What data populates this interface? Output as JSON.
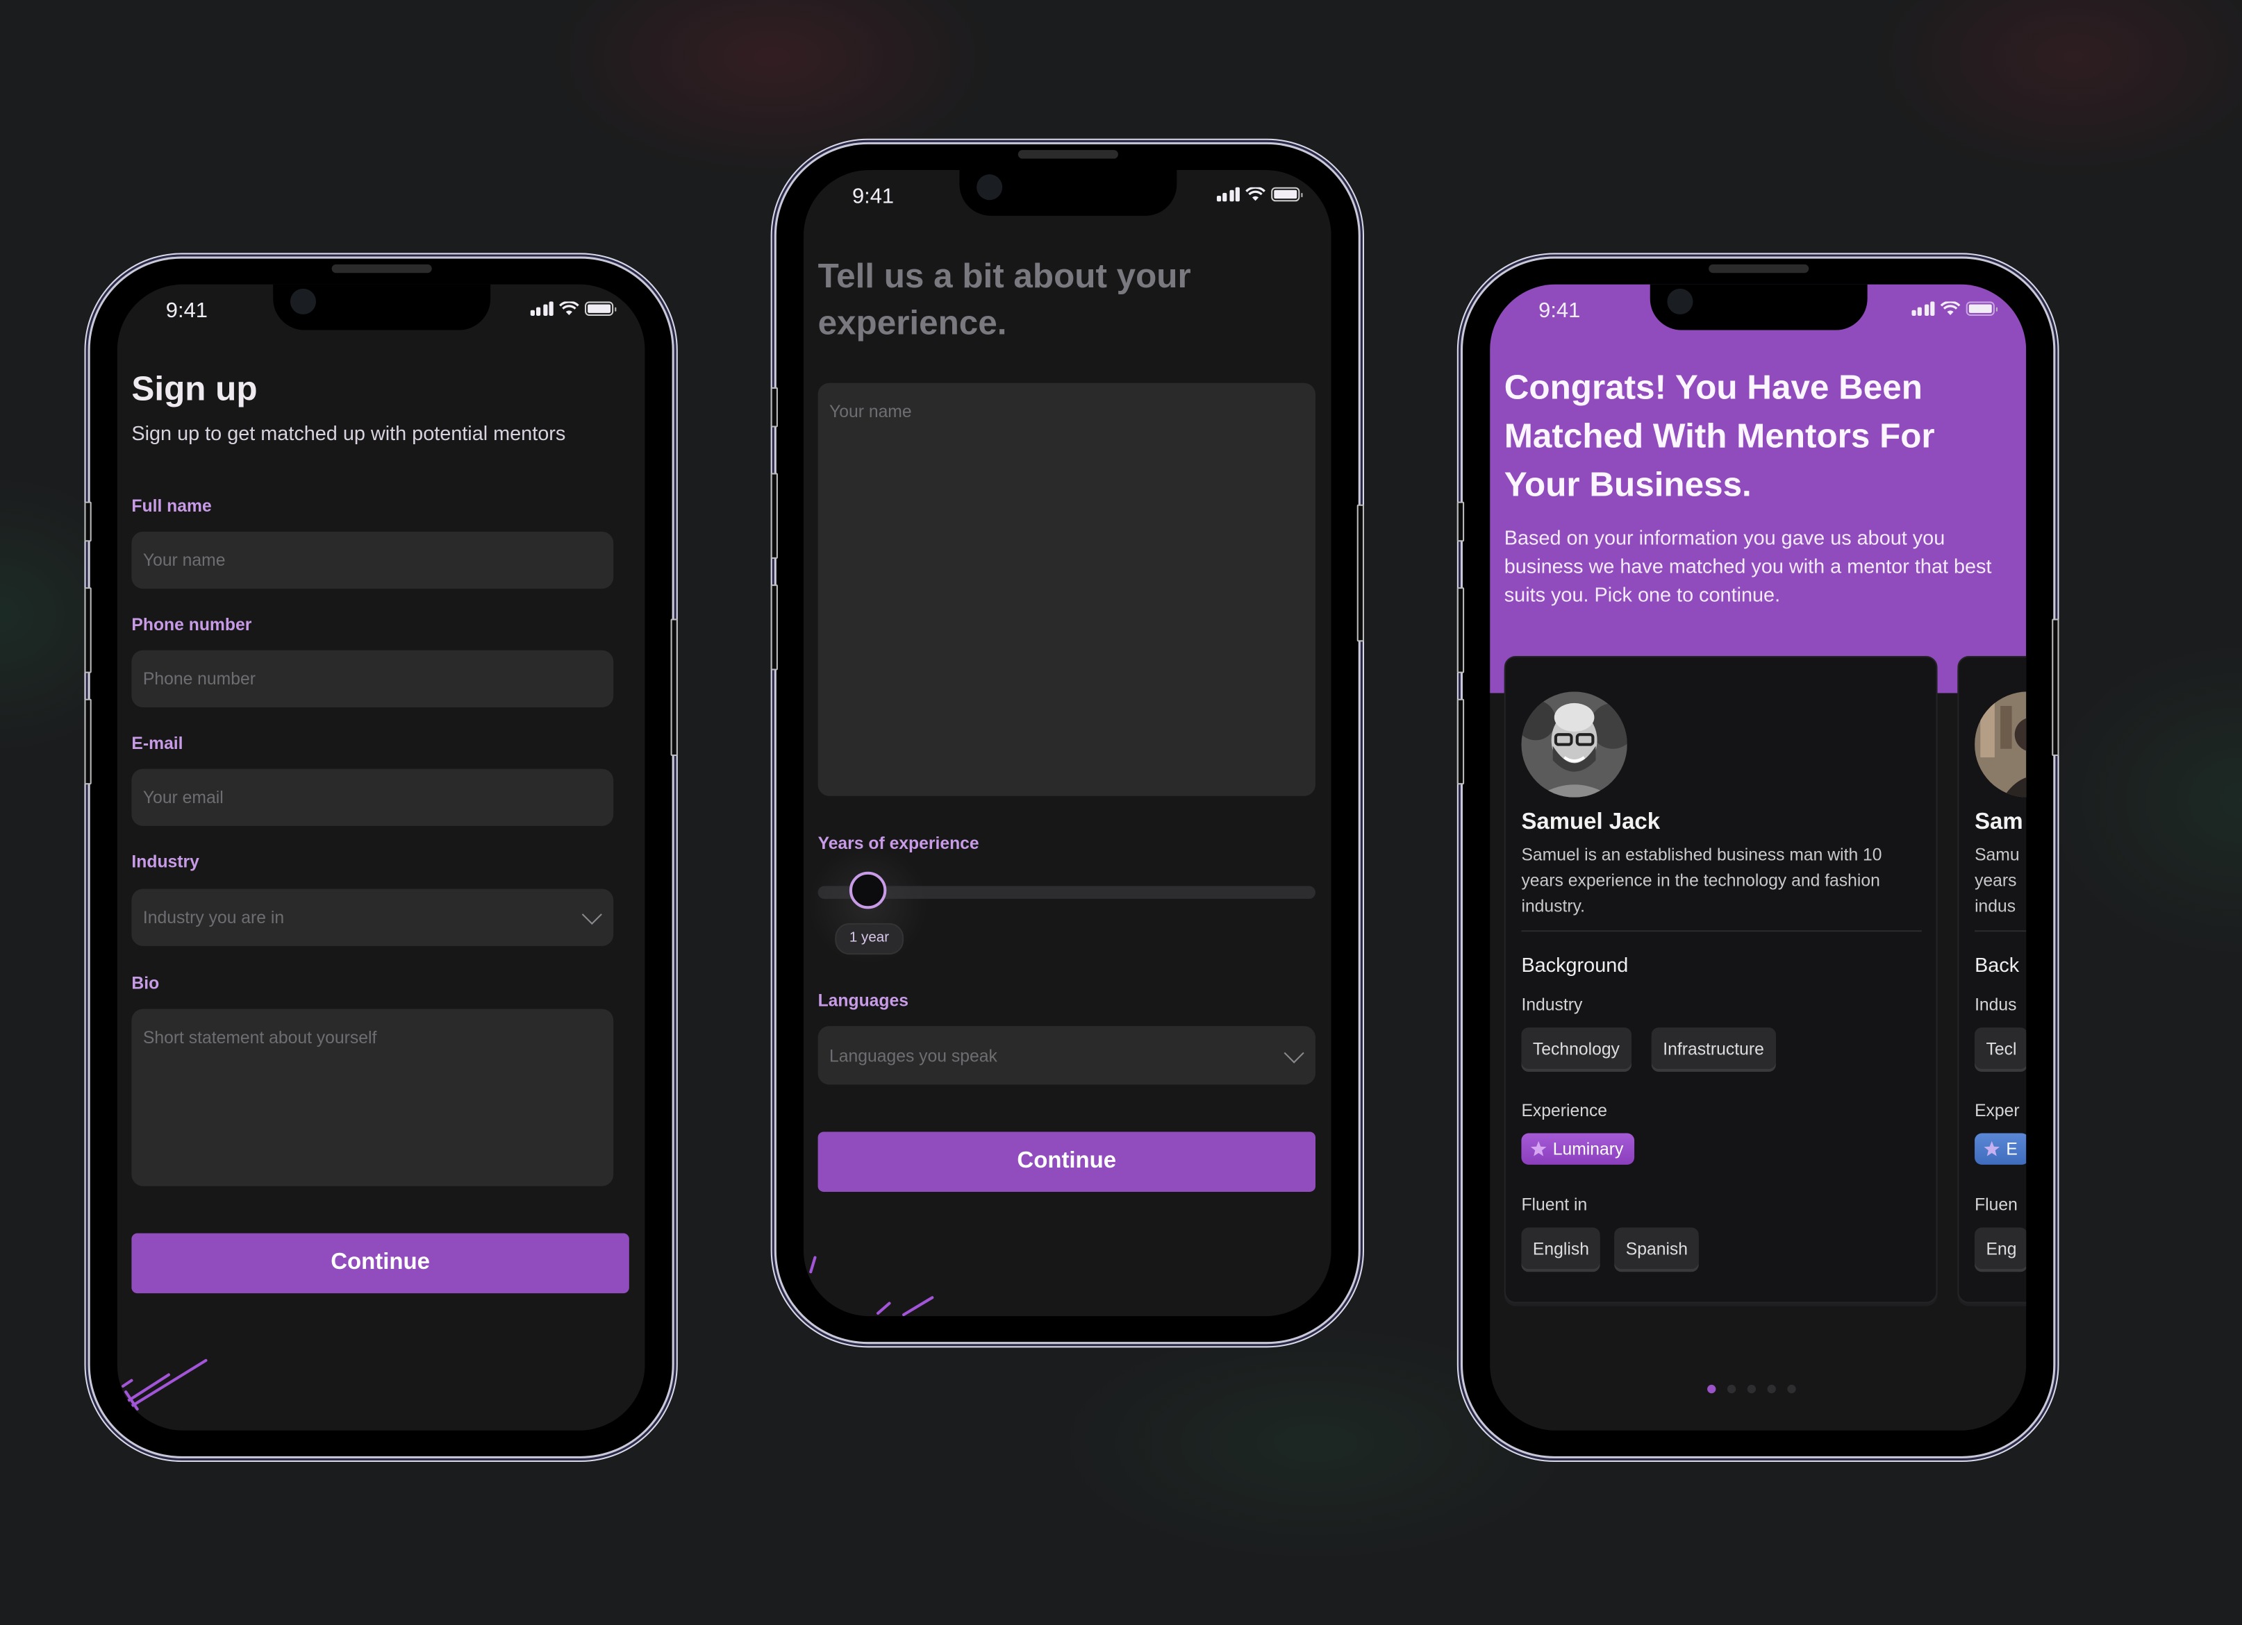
{
  "brand": {
    "accent": "#914dbd",
    "label_color": "#c79be6",
    "screen_bg": "#171718",
    "field_bg": "#2a2a2b"
  },
  "status_bar": {
    "time": "9:41",
    "icons": [
      "cellular-signal-icon",
      "wifi-icon",
      "battery-icon"
    ]
  },
  "signup": {
    "title": "Sign up",
    "subtitle": "Sign up to get matched up with potential mentors",
    "fields": [
      {
        "label": "Full name",
        "placeholder": "Your name",
        "value": ""
      },
      {
        "label": "Phone number",
        "placeholder": "Phone number",
        "value": ""
      },
      {
        "label": "E-mail",
        "placeholder": "Your email",
        "value": ""
      },
      {
        "label": "Industry",
        "placeholder": "Industry you are in",
        "value": "",
        "type": "select"
      },
      {
        "label": "Bio",
        "placeholder": "Short statement about yourself",
        "value": "",
        "type": "textarea"
      }
    ],
    "continue_label": "Continue"
  },
  "experience": {
    "title": "Tell us a bit about your experience.",
    "textarea_placeholder": "Your name",
    "years_label": "Years of experience",
    "years_value": 1,
    "years_value_label": "1 year",
    "languages_label": "Languages",
    "languages_placeholder": "Languages you speak",
    "continue_label": "Continue"
  },
  "matches": {
    "title": "Congrats! You Have Been Matched With Mentors For Your Business.",
    "description": "Based on your information you gave us about you business we have matched you with a mentor that best suits you. Pick one to continue.",
    "mentors": [
      {
        "name": "Samuel Jack",
        "bio": "Samuel is an established business man with 10 years experience in the technology and fashion industry.",
        "background_label": "Background",
        "industry_label": "Industry",
        "industries": [
          "Technology",
          "Infrastructure"
        ],
        "experience_label": "Experience",
        "experience_badge": "Luminary",
        "experience_badge_color": "#9a4fcb",
        "fluent_label": "Fluent in",
        "languages": [
          "English",
          "Spanish"
        ]
      },
      {
        "name": "Sam",
        "bio_lines": [
          "Samu",
          "years",
          "indus"
        ],
        "background_label": "Back",
        "industry_label": "Indus",
        "industries": [
          "Tecl"
        ],
        "experience_label": "Exper",
        "experience_badge": "E",
        "experience_badge_color": "#4a78c8",
        "fluent_label": "Fluen",
        "languages": [
          "Eng"
        ]
      }
    ],
    "pagination": {
      "total": 5,
      "active": 1
    }
  }
}
